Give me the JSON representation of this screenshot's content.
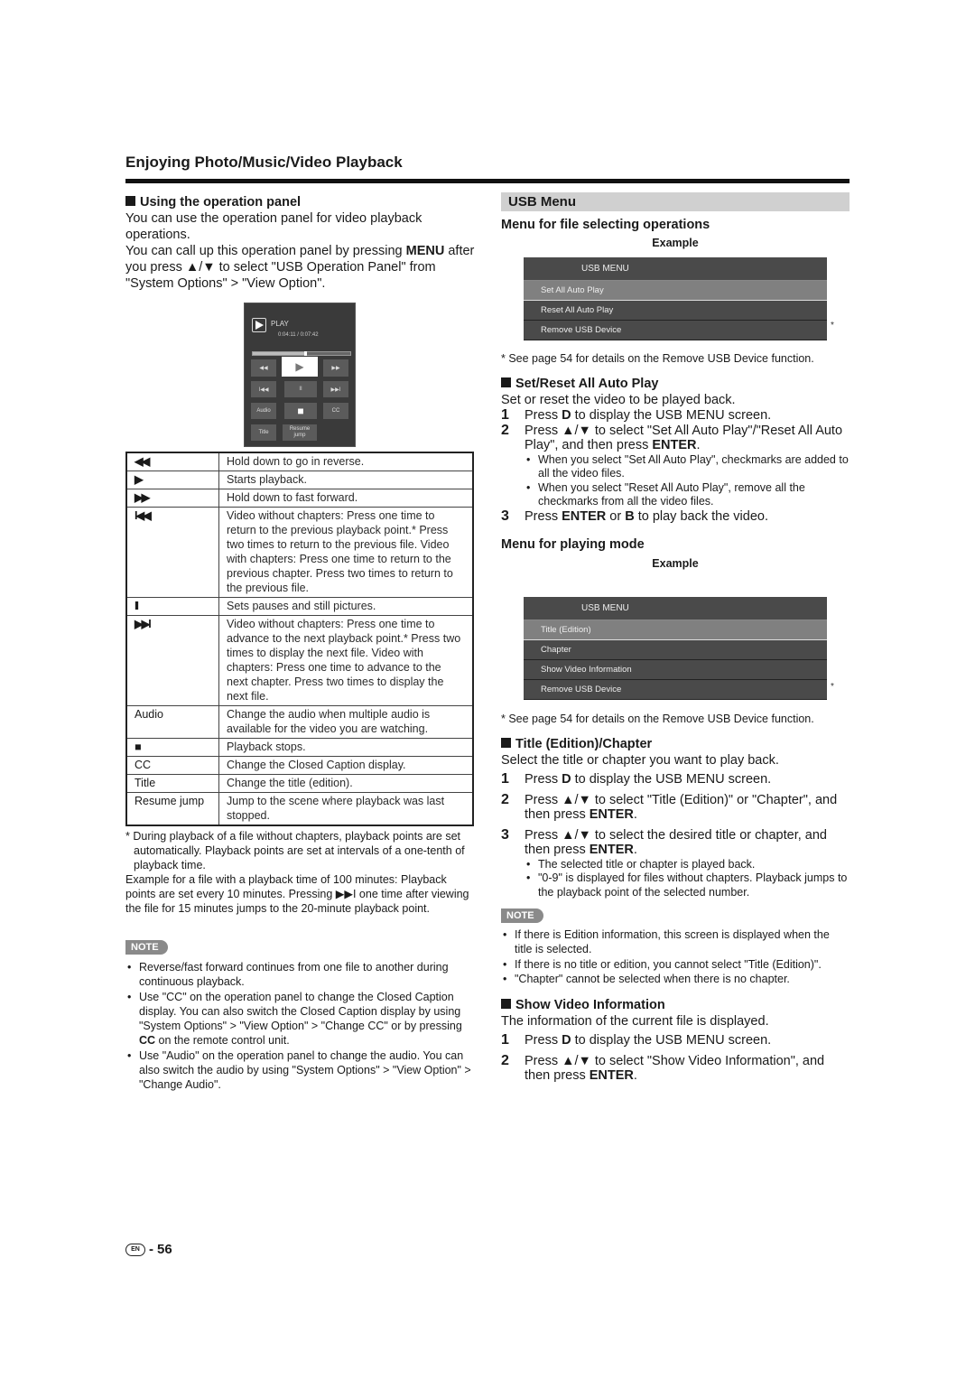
{
  "page": {
    "title": "Enjoying Photo/Music/Video Playback",
    "page_number": "56",
    "language_badge": "EN"
  },
  "left": {
    "operation_panel_section": {
      "heading": "Using the operation panel",
      "intro1": "You can use the operation panel for video playback operations.",
      "intro2_pre": "You can call up this operation panel by pressing ",
      "intro2_key": "MENU",
      "intro2_post": " after you press ▲/▼ to select \"USB Operation Panel\" from \"System Options\" > \"View Option\"."
    },
    "panel": {
      "status": "PLAY",
      "time": "0:04:11 / 0:07:42",
      "progress_fraction": 0.54,
      "buttons": {
        "rewind": "◀◀",
        "play": "▶",
        "fast_forward": "▶▶",
        "prev": "I◀◀",
        "pause": "II",
        "next": "▶▶I",
        "audio": "Audio",
        "stop": "■",
        "cc": "CC",
        "title": "Title",
        "resume_jump": "Resume jump"
      }
    },
    "table": [
      {
        "key": "◀◀",
        "desc": "Hold down to go in reverse."
      },
      {
        "key": "▶",
        "desc": "Starts playback."
      },
      {
        "key": "▶▶",
        "desc": "Hold down to fast forward."
      },
      {
        "key": "I◀◀",
        "desc": "Video without chapters: Press one time to return to the previous playback point.* Press two times to return to the previous file. Video with chapters: Press one time to return to the previous chapter. Press two times to return to the previous file."
      },
      {
        "key": "II",
        "desc": "Sets pauses and still pictures."
      },
      {
        "key": "▶▶I",
        "desc": "Video without chapters: Press one time to advance to the next playback point.* Press two times to display the next file. Video with chapters: Press one time to advance to the next chapter. Press two times to display the next file."
      },
      {
        "key": "Audio",
        "desc": "Change the audio when multiple audio is available for the video you are watching."
      },
      {
        "key": "■",
        "desc": "Playback stops."
      },
      {
        "key": "CC",
        "desc": "Change the Closed Caption display."
      },
      {
        "key": "Title",
        "desc": "Change the title (edition)."
      },
      {
        "key": "Resume jump",
        "desc": "Jump to the scene where playback was last stopped."
      }
    ],
    "footnote": "* During playback of a file without chapters, playback points are set automatically. Playback points are set at intervals of a one-tenth of playback time.",
    "example_text": "Example for a file with a playback time of 100 minutes: Playback points are set every 10 minutes. Pressing ▶▶I one time after viewing the file for 15 minutes jumps to the 20-minute playback point.",
    "note_label": "NOTE",
    "notes": [
      "Reverse/fast forward continues from one file to another during continuous playback.",
      "Use \"CC\" on the operation panel to change the Closed Caption display. You can also switch the Closed Caption display by using \"System Options\" > \"View Option\" > \"Change CC\" or by pressing CC on the remote control unit.",
      "Use \"Audio\" on the operation panel to change the audio. You can also switch the audio by using \"System Options\" > \"View Option\" > \"Change Audio\"."
    ]
  },
  "right": {
    "usb_menu_heading": "USB Menu",
    "file_ops": {
      "heading": "Menu for file selecting operations",
      "example_label": "Example",
      "menu_title": "USB MENU",
      "items": [
        "Set All Auto Play",
        "Reset All Auto Play",
        "Remove USB Device"
      ],
      "selected_index": 0,
      "asterisk": "*",
      "footnote": "* See page 54 for details on the Remove USB Device function."
    },
    "set_reset": {
      "heading": "Set/Reset All Auto Play",
      "intro": "Set or reset the video to be played back.",
      "step1": {
        "num": "1",
        "pre": "Press ",
        "key": "D",
        "post": " to display the USB MENU screen."
      },
      "step2": {
        "num": "2",
        "pre": "Press ▲/▼ to select \"Set All Auto Play\"/\"Reset All Auto Play\", and then press ",
        "key": "ENTER",
        "post": "."
      },
      "step2_notes": [
        "When you select \"Set All Auto Play\", checkmarks are added to all the video files.",
        "When you select \"Reset All Auto Play\", remove all the checkmarks from all the video files."
      ],
      "step3": {
        "num": "3",
        "pre": "Press ",
        "key": "ENTER",
        "mid": " or ",
        "key2": "B",
        "post": " to play back the video."
      }
    },
    "play_mode": {
      "heading": "Menu for playing mode",
      "example_label": "Example",
      "menu_title": "USB MENU",
      "items": [
        "Title (Edition)",
        "Chapter",
        "Show Video Information",
        "Remove USB Device"
      ],
      "selected_index": 0,
      "asterisk": "*",
      "footnote": "* See page 54 for details on the Remove USB Device function."
    },
    "title_chapter": {
      "heading": "Title (Edition)/Chapter",
      "intro": "Select the title or chapter you want to play back.",
      "step1": {
        "num": "1",
        "pre": "Press ",
        "key": "D",
        "post": " to display the USB MENU screen."
      },
      "step2": {
        "num": "2",
        "pre": "Press ▲/▼ to select \"Title (Edition)\" or \"Chapter\", and then press ",
        "key": "ENTER",
        "post": "."
      },
      "step3": {
        "num": "3",
        "pre": "Press ▲/▼ to select the desired title or chapter, and then press ",
        "key": "ENTER",
        "post": "."
      },
      "step3_notes": [
        "The selected title or chapter is played back.",
        "\"0-9\" is displayed for files without chapters. Playback jumps to the playback point of the selected number."
      ]
    },
    "note_label": "NOTE",
    "notes": [
      "If there is Edition information, this screen is displayed when the title is selected.",
      "If there is no title or edition, you cannot select \"Title (Edition)\".",
      "\"Chapter\" cannot be selected when there is no chapter."
    ],
    "show_video": {
      "heading": "Show Video Information",
      "intro": "The information of the current file is displayed.",
      "step1": {
        "num": "1",
        "pre": "Press ",
        "key": "D",
        "post": " to display the USB MENU screen."
      },
      "step2": {
        "num": "2",
        "pre": "Press ▲/▼ to select \"Show Video Information\", and then press ",
        "key": "ENTER",
        "post": "."
      }
    }
  }
}
